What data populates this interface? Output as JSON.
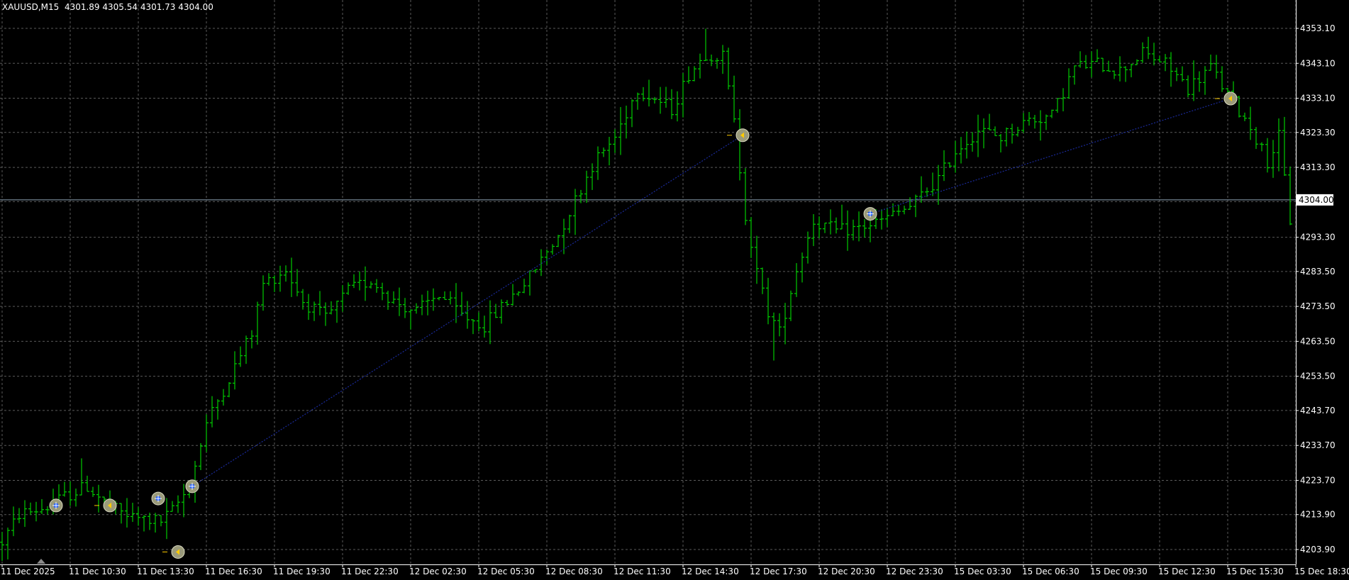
{
  "header": {
    "symbol": "XAUUSD,M15",
    "ohlc": "4301.89 4305.54 4301.73 4304.00"
  },
  "colors": {
    "background": "#000000",
    "grid": "#5a5a5a",
    "bar": "#00cc00",
    "price_line": "#8fa6b8",
    "trade_line": "#1a2a9a",
    "axis_text": "#ffffff",
    "marker_fill": "#9a9a7a"
  },
  "chart_data": {
    "type": "bar",
    "symbol": "XAUUSD",
    "timeframe": "M15",
    "grid": true,
    "y_axis": {
      "ticks": [
        4353.1,
        4343.1,
        4333.1,
        4323.3,
        4313.3,
        4303.5,
        4293.3,
        4283.5,
        4273.5,
        4263.5,
        4253.5,
        4243.7,
        4233.7,
        4223.7,
        4213.9,
        4203.9
      ],
      "labels": [
        "4353.10",
        "4343.10",
        "4333.10",
        "4323.30",
        "4313.30",
        "",
        "4293.30",
        "4283.50",
        "4273.50",
        "4263.50",
        "4253.50",
        "4243.70",
        "4233.70",
        "4223.70",
        "4213.90",
        "4203.90"
      ],
      "ylim": [
        4201.5,
        4358.5
      ],
      "position": "right"
    },
    "x_axis": {
      "ticks": [
        "11 Dec 2025",
        "11 Dec 10:30",
        "11 Dec 13:30",
        "11 Dec 16:30",
        "11 Dec 19:30",
        "11 Dec 22:30",
        "12 Dec 02:30",
        "12 Dec 05:30",
        "12 Dec 08:30",
        "12 Dec 11:30",
        "12 Dec 14:30",
        "12 Dec 17:30",
        "12 Dec 20:30",
        "12 Dec 23:30",
        "15 Dec 03:30",
        "15 Dec 06:30",
        "15 Dec 09:30",
        "15 Dec 12:30",
        "15 Dec 15:30",
        "15 Dec 18:30"
      ],
      "tick_bar_index": [
        0,
        12,
        24,
        36,
        48,
        60,
        72,
        84,
        96,
        108,
        120,
        132,
        144,
        156,
        168,
        180,
        192,
        204,
        216,
        228
      ]
    },
    "current_price": 4304.0,
    "current_price_label": "4304.00",
    "series": [
      {
        "type": "ohlc-bars",
        "bar_count": 228,
        "anchors": [
          [
            0,
            4206
          ],
          [
            3,
            4214
          ],
          [
            8,
            4216
          ],
          [
            11,
            4219
          ],
          [
            15,
            4222
          ],
          [
            19,
            4216
          ],
          [
            23,
            4213
          ],
          [
            28,
            4212
          ],
          [
            30,
            4215
          ],
          [
            33,
            4222
          ],
          [
            36,
            4240
          ],
          [
            40,
            4253
          ],
          [
            44,
            4266
          ],
          [
            46,
            4280
          ],
          [
            50,
            4284
          ],
          [
            53,
            4275
          ],
          [
            57,
            4270
          ],
          [
            61,
            4278
          ],
          [
            65,
            4281
          ],
          [
            69,
            4275
          ],
          [
            73,
            4272
          ],
          [
            77,
            4277
          ],
          [
            81,
            4271
          ],
          [
            85,
            4268
          ],
          [
            89,
            4275
          ],
          [
            93,
            4282
          ],
          [
            98,
            4294
          ],
          [
            104,
            4314
          ],
          [
            108,
            4322
          ],
          [
            112,
            4336
          ],
          [
            118,
            4330
          ],
          [
            121,
            4340
          ],
          [
            124,
            4346
          ],
          [
            127,
            4345
          ],
          [
            129,
            4326
          ],
          [
            131,
            4300
          ],
          [
            133,
            4283
          ],
          [
            135,
            4272
          ],
          [
            137,
            4266
          ],
          [
            140,
            4284
          ],
          [
            143,
            4298
          ],
          [
            147,
            4295
          ],
          [
            151,
            4296
          ],
          [
            155,
            4298
          ],
          [
            160,
            4302
          ],
          [
            165,
            4310
          ],
          [
            168,
            4318
          ],
          [
            172,
            4324
          ],
          [
            176,
            4322
          ],
          [
            181,
            4327
          ],
          [
            185,
            4328
          ],
          [
            189,
            4342
          ],
          [
            193,
            4343
          ],
          [
            197,
            4341
          ],
          [
            201,
            4346
          ],
          [
            205,
            4343
          ],
          [
            209,
            4336
          ],
          [
            213,
            4342
          ],
          [
            216,
            4334
          ],
          [
            220,
            4325
          ],
          [
            223,
            4315
          ],
          [
            225,
            4322
          ],
          [
            227,
            4298
          ],
          [
            228,
            4304
          ]
        ]
      }
    ],
    "trade_markers": [
      {
        "bar": 9.5,
        "price": 4216.5,
        "kind": "buy"
      },
      {
        "bar": 19,
        "price": 4216.5,
        "kind": "sell"
      },
      {
        "bar": 27.5,
        "price": 4218.5,
        "kind": "buy"
      },
      {
        "bar": 31,
        "price": 4203.2,
        "kind": "sell"
      },
      {
        "bar": 33.5,
        "price": 4222.0,
        "kind": "buy"
      },
      {
        "bar": 130.5,
        "price": 4322.5,
        "kind": "sell"
      },
      {
        "bar": 153,
        "price": 4300.0,
        "kind": "buy"
      },
      {
        "bar": 216.5,
        "price": 4333.0,
        "kind": "sell"
      }
    ],
    "trade_lines": [
      {
        "from": [
          33.5,
          4222.0
        ],
        "to": [
          130.5,
          4322.5
        ]
      },
      {
        "from": [
          153,
          4300.0
        ],
        "to": [
          216.5,
          4333.0
        ]
      }
    ]
  }
}
